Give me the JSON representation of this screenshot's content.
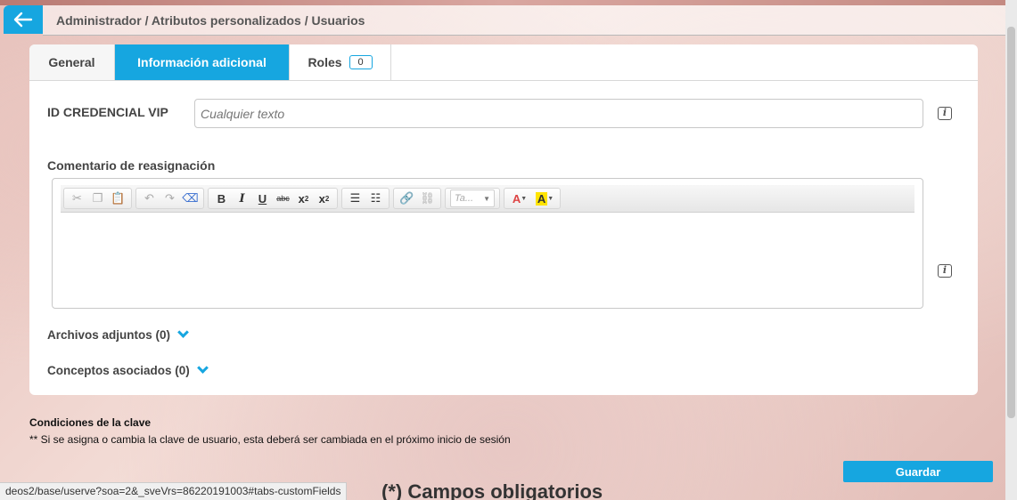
{
  "header": {
    "breadcrumb": "Administrador / Atributos personalizados / Usuarios"
  },
  "tabs": [
    {
      "label": "General",
      "active": false
    },
    {
      "label": "Información adicional",
      "active": true
    },
    {
      "label": "Roles",
      "count": "0",
      "active": false
    }
  ],
  "form": {
    "id_credencial": {
      "label": "ID CREDENCIAL VIP",
      "placeholder": "Cualquier texto",
      "value": ""
    },
    "comentario": {
      "label": "Comentario de reasignación",
      "styles_placeholder": "Ta..."
    },
    "archivos": "Archivos adjuntos (0)",
    "conceptos": "Conceptos asociados (0)"
  },
  "footer": {
    "conditions_title": "Condiciones de la clave",
    "conditions_note": "** Si se asigna o cambia la clave de usuario, esta deberá ser cambiada en el próximo inicio de sesión",
    "save_label": "Guardar",
    "required_note": "(*) Campos obligatorios"
  },
  "status_url": "deos2/base/userve?soa=2&_sveVrs=86220191003#tabs-customFields",
  "colors": {
    "accent": "#16a6e0",
    "panel": "#ffffff"
  },
  "icons": {
    "back": "arrow-left-icon",
    "info": "info-icon",
    "expand": "chevron-down-icon"
  }
}
